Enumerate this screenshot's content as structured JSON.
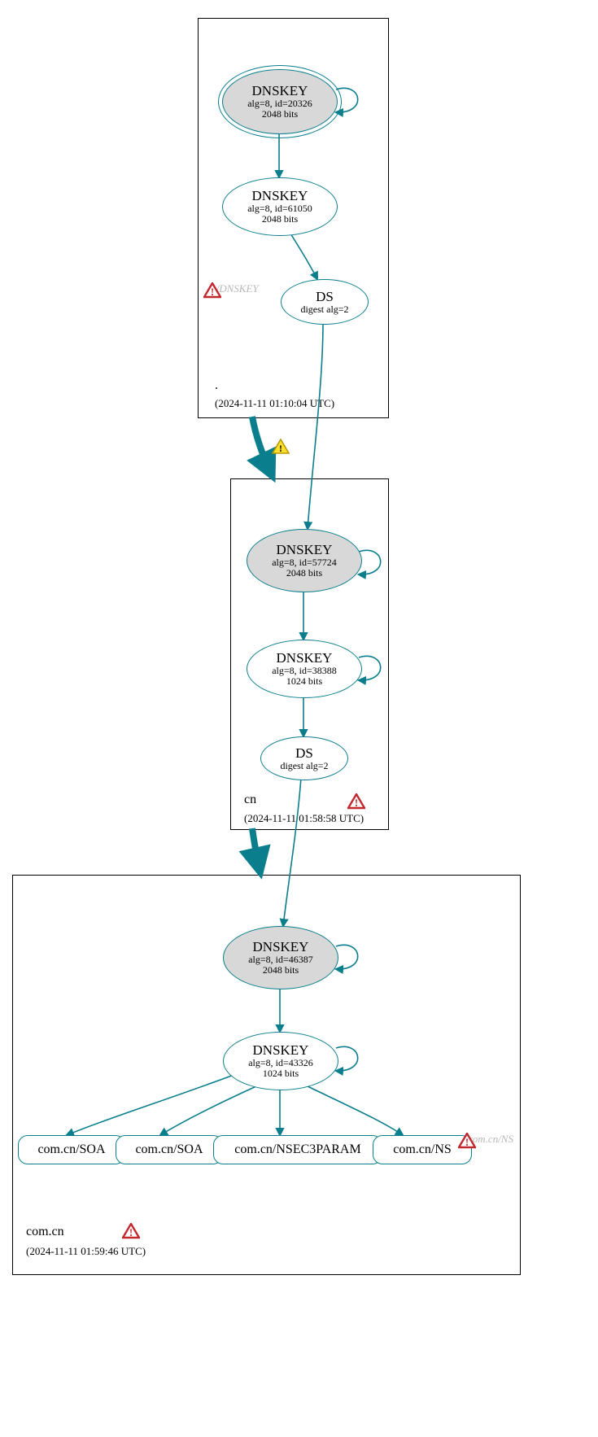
{
  "zones": {
    "root": {
      "name": ".",
      "timestamp": "(2024-11-11 01:10:04 UTC)"
    },
    "cn": {
      "name": "cn",
      "timestamp": "(2024-11-11 01:58:58 UTC)"
    },
    "comcn": {
      "name": "com.cn",
      "timestamp": "(2024-11-11 01:59:46 UTC)"
    }
  },
  "nodes": {
    "root_ksk": {
      "title": "DNSKEY",
      "line1": "alg=8, id=20326",
      "line2": "2048 bits"
    },
    "root_zsk": {
      "title": "DNSKEY",
      "line1": "alg=8, id=61050",
      "line2": "2048 bits"
    },
    "root_ds": {
      "title": "DS",
      "line1": "digest alg=2",
      "line2": ""
    },
    "cn_ksk": {
      "title": "DNSKEY",
      "line1": "alg=8, id=57724",
      "line2": "2048 bits"
    },
    "cn_zsk": {
      "title": "DNSKEY",
      "line1": "alg=8, id=38388",
      "line2": "1024 bits"
    },
    "cn_ds": {
      "title": "DS",
      "line1": "digest alg=2",
      "line2": ""
    },
    "comcn_ksk": {
      "title": "DNSKEY",
      "line1": "alg=8, id=46387",
      "line2": "2048 bits"
    },
    "comcn_zsk": {
      "title": "DNSKEY",
      "line1": "alg=8, id=43326",
      "line2": "1024 bits"
    }
  },
  "rrsets": {
    "soa1": "com.cn/SOA",
    "soa2": "com.cn/SOA",
    "nsec3": "com.cn/NSEC3PARAM",
    "ns": "com.cn/NS"
  },
  "error_nodes": {
    "root_dnskey": "./DNSKEY",
    "comcn_ns": "com.cn/NS"
  },
  "colors": {
    "edge": "#0a7e8c",
    "err": "#c1272d",
    "warn_fill": "#ffe02e",
    "warn_edge": "#b79a00"
  }
}
